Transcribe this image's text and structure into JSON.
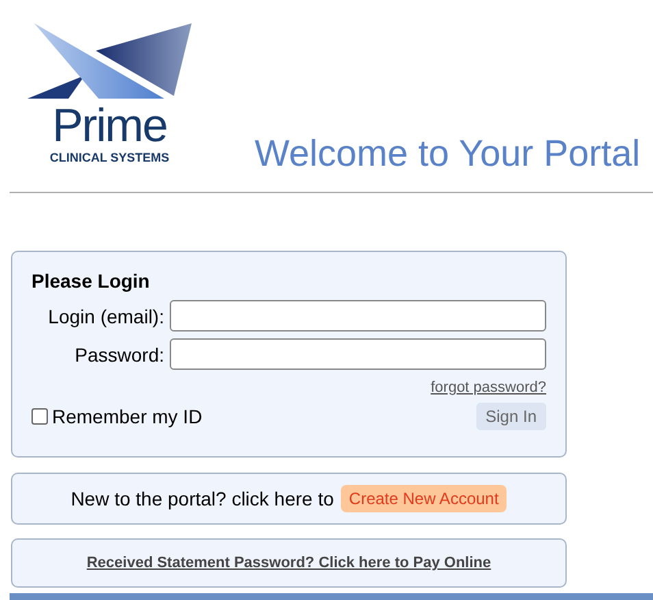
{
  "logo": {
    "name": "Prime",
    "tagline": "CLINICAL SYSTEMS"
  },
  "title": "Welcome to Your Portal",
  "login": {
    "heading": "Please Login",
    "fields": [
      {
        "label": "Login (email):"
      },
      {
        "label": "Password:"
      }
    ],
    "forgot_link": "forgot password?",
    "remember": {
      "label": "Remember my ID",
      "checked": false
    },
    "sign_in": "Sign In"
  },
  "new_account": {
    "text": "New to the portal? click here to",
    "button": "Create New Account"
  },
  "pay_link": "Received Statement Password? Click here to Pay Online"
}
